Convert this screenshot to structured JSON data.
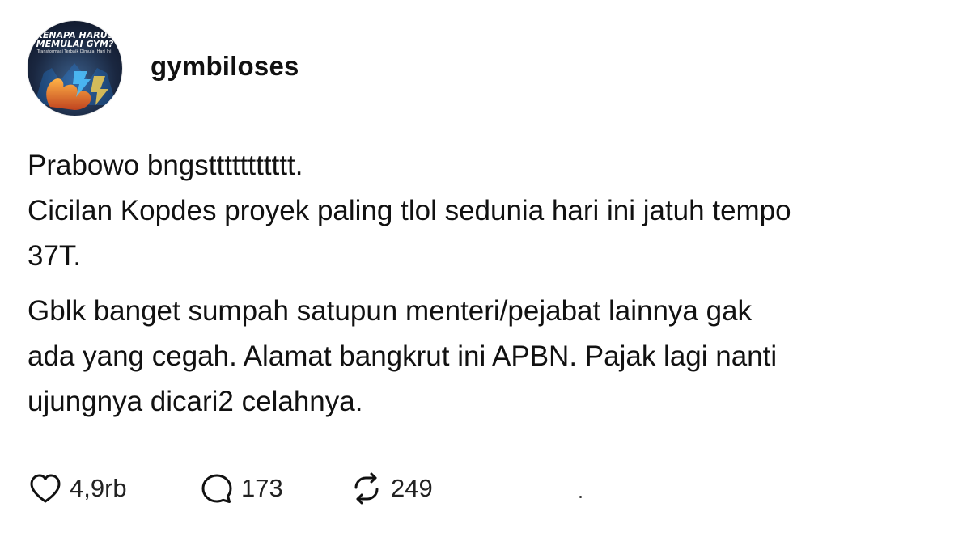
{
  "post": {
    "avatar": {
      "line1": "KENAPA HARUS",
      "line2": "MEMULAI GYM?",
      "line3": "Transformasi Terbaik Dimulai Hari Ini."
    },
    "username": "gymbiloses",
    "paragraph1": [
      "Prabowo bngsttttttttttt.",
      "Cicilan Kopdes proyek paling tlol sedunia hari ini jatuh tempo",
      "37T."
    ],
    "paragraph2": [
      "Gblk banget sumpah satupun menteri/pejabat lainnya gak",
      "ada yang cegah. Alamat bangkrut ini APBN. Pajak lagi nanti",
      "ujungnya dicari2 celahnya."
    ],
    "actions": {
      "likes": "4,9rb",
      "comments": "173",
      "reposts": "249"
    }
  },
  "icons": {
    "like": "heart-icon",
    "comment": "comment-bubble-icon",
    "repost": "repost-arrows-icon"
  },
  "colors": {
    "text": "#111111",
    "background": "#ffffff"
  }
}
